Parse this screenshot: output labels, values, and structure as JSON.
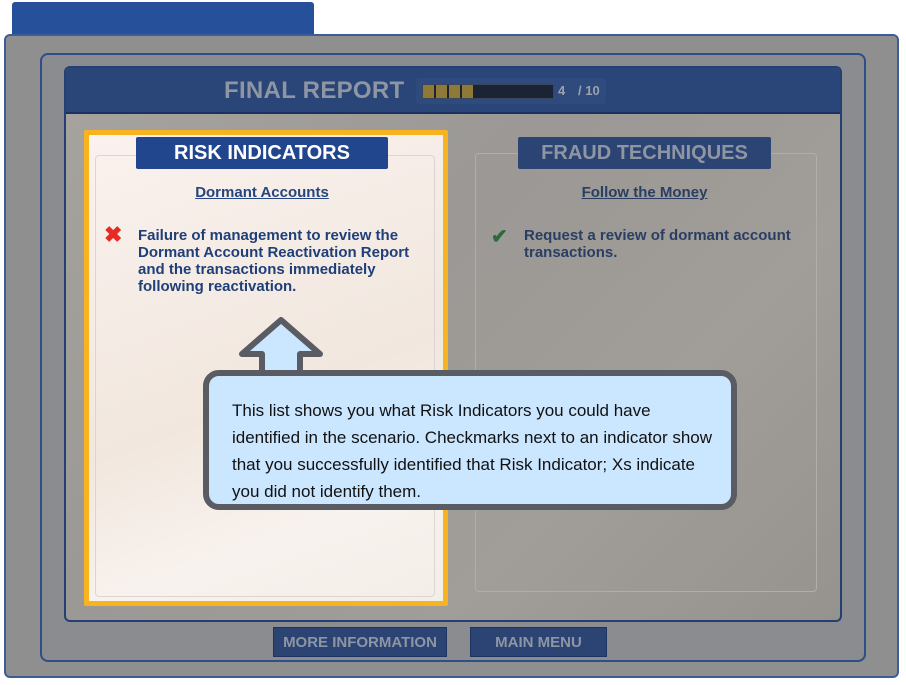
{
  "header": {
    "title": "FINAL REPORT",
    "progress_current": "4",
    "progress_total": "/ 10",
    "progress_fraction": 0.4
  },
  "risk": {
    "header": "RISK INDICATORS",
    "subtitle": "Dormant Accounts",
    "item_status_icon": "x-icon",
    "item_text": "Failure of management to review the Dormant Account Reactivation Report and the transactions immediately following reactivation."
  },
  "fraud": {
    "header": "FRAUD TECHNIQUES",
    "subtitle": "Follow the Money",
    "item_status_icon": "check-icon",
    "item_text": "Request a review of dormant account transactions."
  },
  "callout": {
    "text": "This list shows you what Risk Indicators you could have identified in the scenario. Checkmarks next to an indicator show that you successfully identified that Risk Indicator; Xs indicate you did not identify them."
  },
  "buttons": {
    "more_info": "MORE INFORMATION",
    "main_menu": "MAIN MENU"
  },
  "colors": {
    "accent_blue": "#21468e",
    "highlight": "#f7b320",
    "x_red": "#e52b23",
    "check_green": "#2f6a3a",
    "callout_bg": "#cbe6ff"
  }
}
